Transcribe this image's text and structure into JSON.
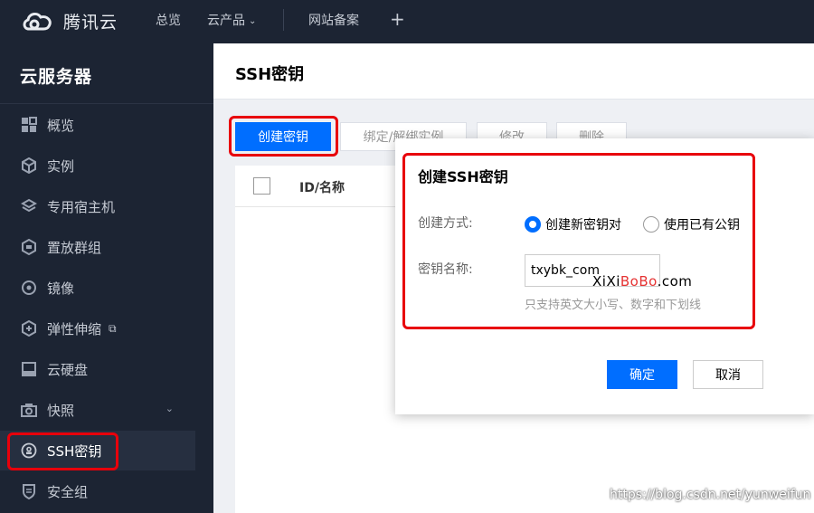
{
  "topbar": {
    "logo_text": "腾讯云",
    "nav": [
      "总览",
      "云产品",
      "网站备案"
    ],
    "plus": "+"
  },
  "sidebar": {
    "title": "云服务器",
    "items": [
      {
        "label": "概览",
        "icon": "grid-icon"
      },
      {
        "label": "实例",
        "icon": "cube-icon"
      },
      {
        "label": "专用宿主机",
        "icon": "layers-icon"
      },
      {
        "label": "置放群组",
        "icon": "group-icon"
      },
      {
        "label": "镜像",
        "icon": "disc-icon"
      },
      {
        "label": "弹性伸缩",
        "icon": "scale-icon",
        "ext": "⧉"
      },
      {
        "label": "云硬盘",
        "icon": "disk-icon"
      },
      {
        "label": "快照",
        "icon": "camera-icon",
        "chevron": "⌄"
      },
      {
        "label": "SSH密钥",
        "icon": "key-icon"
      },
      {
        "label": "安全组",
        "icon": "shield-icon"
      }
    ],
    "active_index": 8
  },
  "main": {
    "title": "SSH密钥",
    "toolbar": {
      "create": "创建密钥",
      "bind": "绑定/解绑实例",
      "edit": "修改",
      "delete": "删除"
    },
    "table": {
      "col_id": "ID/名称"
    }
  },
  "dialog": {
    "title": "创建SSH密钥",
    "method_label": "创建方式:",
    "option_new": "创建新密钥对",
    "option_existing": "使用已有公钥",
    "selected": "new",
    "name_label": "密钥名称:",
    "name_value": "txybk_com",
    "hint": "只支持英文大小写、数字和下划线",
    "confirm": "确定",
    "cancel": "取消"
  },
  "watermark": {
    "part1": "XiXi",
    "part2": "BoBo",
    "part3": ".com"
  },
  "footer_url": "https://blog.csdn.net/yunweifun",
  "colors": {
    "primary": "#006eff",
    "highlight": "#e8000b",
    "sidebar_bg": "#1c2433"
  }
}
